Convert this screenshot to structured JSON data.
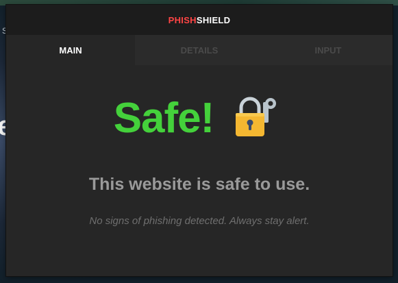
{
  "background": {
    "fragment_text": "e",
    "fragment_small": "S"
  },
  "header": {
    "brand_part1": "PHISH",
    "brand_part2": "SHIELD",
    "brand_color_1": "#ff4545",
    "brand_color_2": "#ffffff"
  },
  "tabs": [
    {
      "label": "MAIN",
      "active": true
    },
    {
      "label": "DETAILS",
      "active": false
    },
    {
      "label": "INPUT",
      "active": false
    }
  ],
  "status": {
    "title": "Safe!",
    "title_color": "#44d13b",
    "icon": "locked-padlock-with-key-icon",
    "message": "This website is safe to use.",
    "note": "No signs of phishing detected. Always stay alert."
  }
}
